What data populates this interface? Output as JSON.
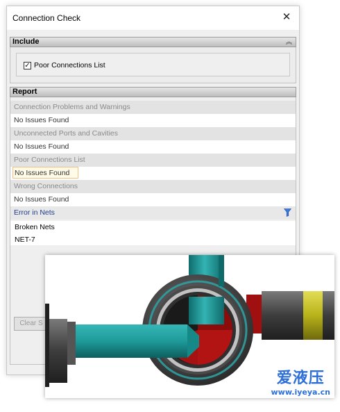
{
  "window": {
    "title": "Connection Check",
    "close_glyph": "✕"
  },
  "include": {
    "header": "Include",
    "collapse_glyph": "︽",
    "checkbox": {
      "label": "Poor Connections List",
      "checked": true
    }
  },
  "report": {
    "header": "Report",
    "categories": [
      {
        "name": "Connection Problems and Warnings",
        "value": "No Issues Found"
      },
      {
        "name": "Unconnected Ports and Cavities",
        "value": "No Issues Found"
      },
      {
        "name": "Poor Connections List",
        "value": "No Issues Found"
      },
      {
        "name": "Wrong Connections",
        "value": "No Issues Found"
      }
    ],
    "error_header": "Error in Nets",
    "nets": [
      "Broken Nets",
      "NET-7"
    ]
  },
  "buttons": {
    "clear": "Clear S"
  },
  "watermark": {
    "brand": "爱液压",
    "url": "www.iyeya.cn"
  },
  "colors": {
    "pipe_teal": "#1f9a9a",
    "valve_red": "#b01818",
    "accent_yellow": "#c8c21e",
    "link_blue": "#1c3d8a"
  }
}
